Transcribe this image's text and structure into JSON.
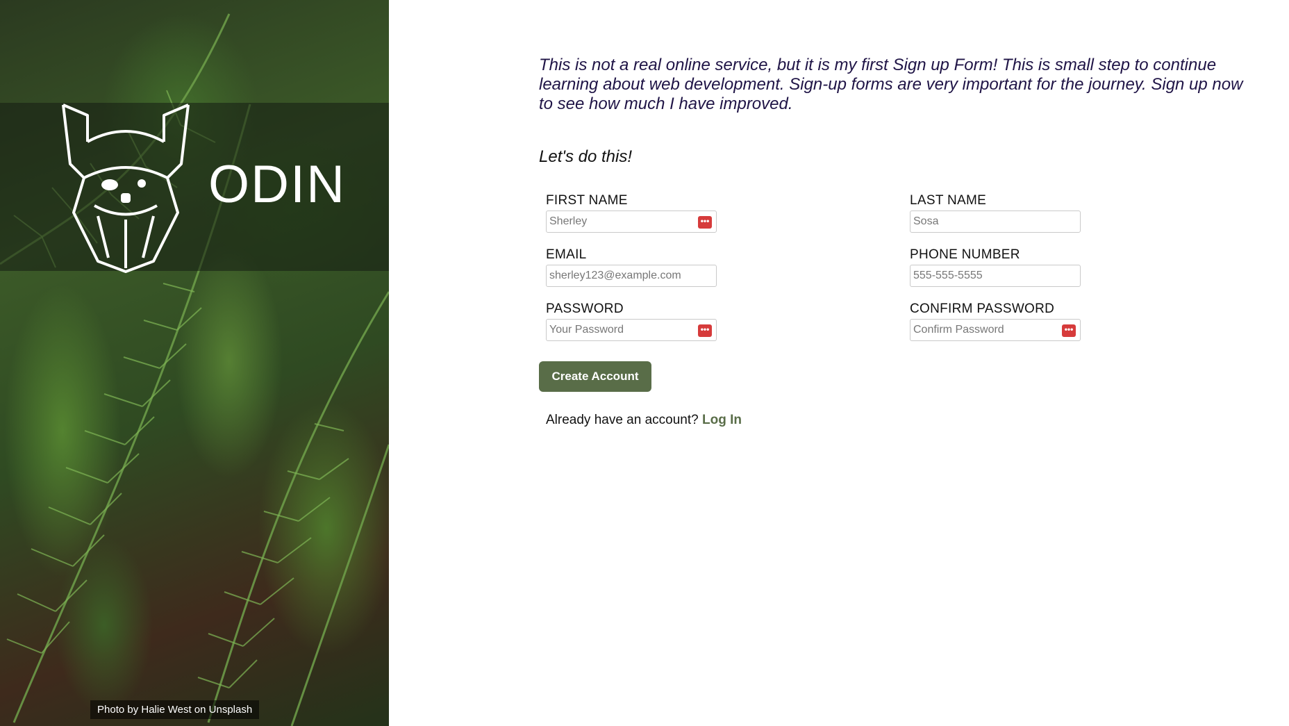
{
  "sidebar": {
    "brand": "ODIN",
    "logo_icon": "viking-helmet-logo-icon",
    "photo_credit": "Photo by Halie West on Unsplash"
  },
  "main": {
    "intro": "This is not a real online service, but it is my first Sign up Form! This is small step to continue learning about web development. Sign-up forms are very important for the journey. Sign up now to see how much I have improved.",
    "cta": "Let's do this!"
  },
  "form": {
    "first_name": {
      "label": "FIRST NAME",
      "placeholder": "Sherley",
      "icon": "password-manager-icon"
    },
    "last_name": {
      "label": "LAST NAME",
      "placeholder": "Sosa"
    },
    "email": {
      "label": "EMAIL",
      "placeholder": "sherley123@example.com"
    },
    "phone": {
      "label": "PHONE NUMBER",
      "placeholder": "555-555-5555"
    },
    "password": {
      "label": "PASSWORD",
      "placeholder": "Your Password",
      "icon": "password-manager-icon"
    },
    "confirm_password": {
      "label": "CONFIRM PASSWORD",
      "placeholder": "Confirm Password",
      "icon": "password-manager-icon"
    },
    "submit_label": "Create Account",
    "login_prompt": "Already have an account?",
    "login_link": "Log In",
    "icon_glyph": "•••"
  },
  "colors": {
    "accent": "#596d48",
    "intro_text": "#1f1446",
    "password_icon": "#d63b3b"
  }
}
